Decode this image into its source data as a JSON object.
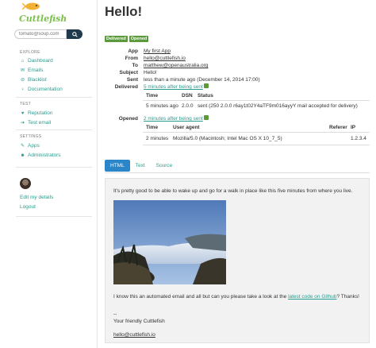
{
  "sidebar": {
    "logo": "Cuttlefish",
    "search_placeholder": "tomato@soup.com",
    "explore_heading": "EXPLORE",
    "explore_items": [
      "Dashboard",
      "Emails",
      "Blacklist",
      "Documentation"
    ],
    "test_heading": "TEST",
    "test_items": [
      "Reputation",
      "Test email"
    ],
    "settings_heading": "SETTINGS",
    "settings_items": [
      "Apps",
      "Administrators"
    ],
    "edit_details": "Edit my details",
    "logout": "Logout"
  },
  "page": {
    "title": "Hello!",
    "badges": [
      "Delivered",
      "Opened"
    ]
  },
  "details": {
    "app_label": "App",
    "app_value": "My first App",
    "from_label": "From",
    "from_value": "hello@cuttlefish.io",
    "to_label": "To",
    "to_value": "matthew@openaustralia.org",
    "subject_label": "Subject",
    "subject_value": "Hello!",
    "sent_label": "Sent",
    "sent_value": "less than a minute ago (December 14, 2014 17:00)",
    "delivered_label": "Delivered",
    "delivered_value": "5 minutes after being sent",
    "delivery_table": {
      "headers": [
        "Time",
        "DSN",
        "Status"
      ],
      "rows": [
        [
          "5 minutes ago",
          "2.0.0",
          "sent (250 2.0.0 r6ay1t02Y4aTF9m016ayyY mail accepted for delivery)"
        ]
      ]
    },
    "opened_label": "Opened",
    "opened_value": "2 minutes after being sent",
    "open_table": {
      "headers": [
        "Time",
        "User agent",
        "Referer",
        "IP"
      ],
      "rows": [
        [
          "2 minutes",
          "Mozilla/5.0 (Macintosh; Intel Mac OS X 10_7_5)",
          "",
          "1.2.3.4"
        ]
      ]
    }
  },
  "tabs": [
    "HTML",
    "Text",
    "Source"
  ],
  "message": {
    "line1": "It's pretty good to be able to wake up and go for a walk in place like this five minutes from where you live.",
    "line2_before": "I know this an automated email and all but can you please take a look at the ",
    "line2_link": "latest code on Github",
    "line2_after": "? Thanks!",
    "sig_dashes": "--",
    "sig_line": "Your friendly Cuttlefish",
    "sig_email": "hello@cuttlefish.io"
  },
  "colors": {
    "accent": "#2a9d8f",
    "badge": "#5a9a3c",
    "tab_active": "#2a86c9",
    "search_button": "#1f3a4a"
  }
}
